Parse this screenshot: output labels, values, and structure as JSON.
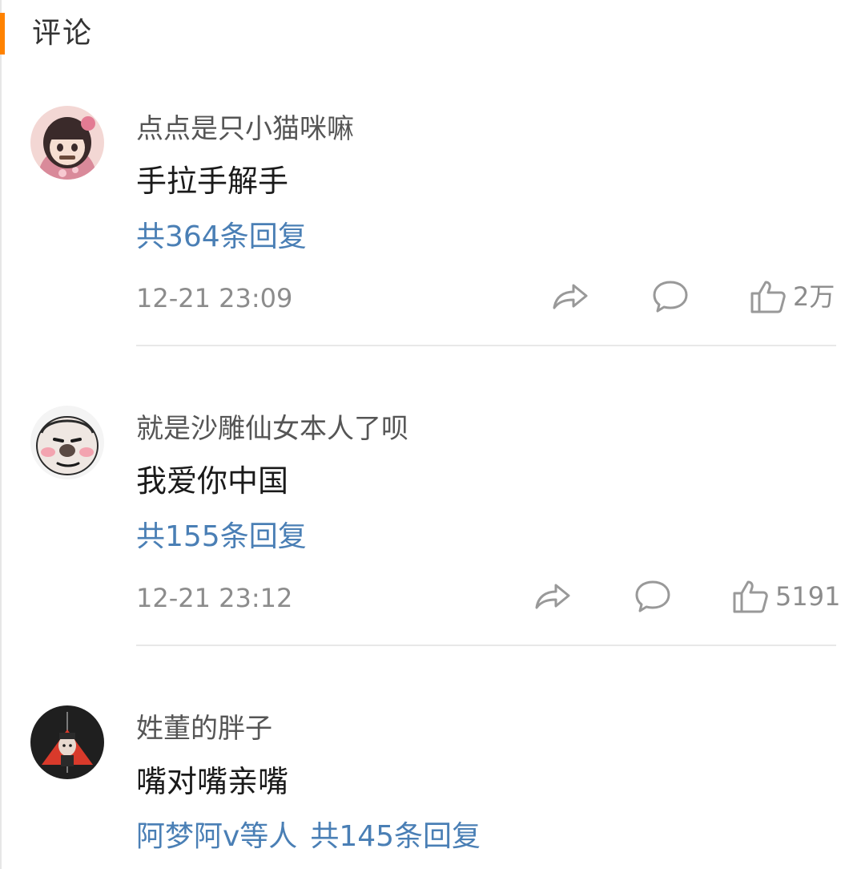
{
  "section": {
    "title": "评论",
    "accent_color": "#ff8200"
  },
  "comments": [
    {
      "username": "点点是只小猫咪嘛",
      "text": "手拉手解手",
      "reply_label": "共364条回复",
      "timestamp": "12-21 23:09",
      "likes": "2万",
      "avatar": "anime-girl-avatar"
    },
    {
      "username": "就是沙雕仙女本人了呗",
      "text": "我爱你中国",
      "reply_label": "共155条回复",
      "timestamp": "12-21 23:12",
      "likes": "5191",
      "avatar": "meme-face-avatar"
    },
    {
      "username": "姓董的胖子",
      "text": "嘴对嘴亲嘴",
      "reply_names": "阿梦阿v等人",
      "reply_label": "共145条回复",
      "avatar": "dark-emblem-avatar"
    }
  ],
  "icons": {
    "share": "share-icon",
    "comment": "comment-icon",
    "like": "thumbs-up-icon"
  },
  "colors": {
    "link": "#4a7fb5",
    "meta": "#8c8c8c",
    "text": "#1a1a1a"
  }
}
